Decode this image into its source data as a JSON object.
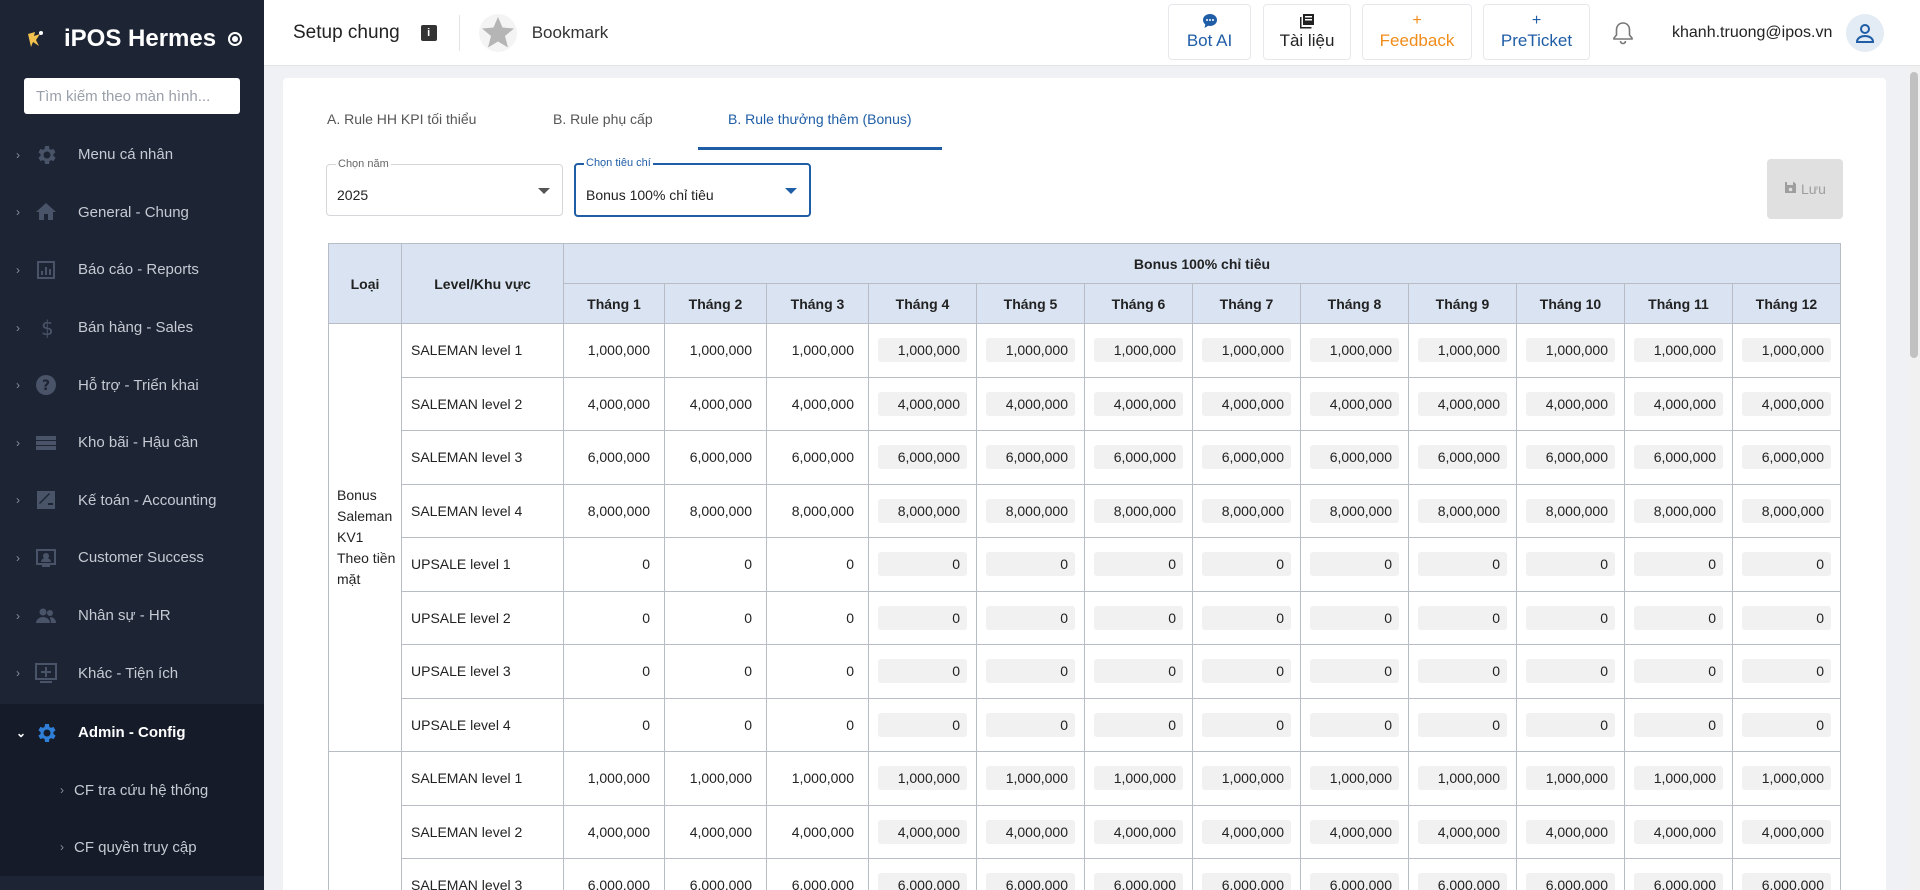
{
  "app": {
    "name": "iPOS Hermes"
  },
  "sidebar": {
    "search_placeholder": "Tìm kiếm theo màn hình...",
    "items": [
      {
        "label": "Menu cá nhân",
        "icon": "gear-icon"
      },
      {
        "label": "General - Chung",
        "icon": "home-icon"
      },
      {
        "label": "Báo cáo - Reports",
        "icon": "bar-chart-icon"
      },
      {
        "label": "Bán hàng - Sales",
        "icon": "dollar-icon"
      },
      {
        "label": "Hỗ trợ - Triển khai",
        "icon": "help-icon"
      },
      {
        "label": "Kho bãi - Hậu cần",
        "icon": "storage-icon"
      },
      {
        "label": "Kế toán - Accounting",
        "icon": "accounting-icon"
      },
      {
        "label": "Customer Success",
        "icon": "customer-icon"
      },
      {
        "label": "Nhân sự - HR",
        "icon": "people-icon"
      },
      {
        "label": "Khác - Tiện ích",
        "icon": "add-box-icon"
      },
      {
        "label": "Admin - Config",
        "icon": "settings-icon",
        "active": true
      }
    ],
    "sub_items": [
      {
        "label": "CF tra cứu hệ thống"
      },
      {
        "label": "CF quyền truy cập"
      }
    ]
  },
  "header": {
    "title": "Setup chung",
    "bookmark_label": "Bookmark",
    "buttons": {
      "bot_ai": "Bot AI",
      "tai_lieu": "Tài liệu",
      "feedback": "Feedback",
      "preticket": "PreTicket"
    },
    "user_email": "khanh.truong@ipos.vn"
  },
  "tabs": [
    {
      "label": "A. Rule HH KPI tối thiểu"
    },
    {
      "label": "B. Rule phụ cấp"
    },
    {
      "label": "B. Rule thưởng thêm (Bonus)",
      "active": true
    }
  ],
  "filters": {
    "year": {
      "label": "Chọn năm",
      "value": "2025"
    },
    "criteria": {
      "label": "Chọn tiêu chí",
      "value": "Bonus 100% chỉ tiêu"
    }
  },
  "save_label": "Lưu",
  "table": {
    "col_loai": "Loại",
    "col_level": "Level/Khu vực",
    "group_header": "Bonus 100% chỉ tiêu",
    "months": [
      "Tháng 1",
      "Tháng 2",
      "Tháng 3",
      "Tháng 4",
      "Tháng 5",
      "Tháng 6",
      "Tháng 7",
      "Tháng 8",
      "Tháng 9",
      "Tháng 10",
      "Tháng 11",
      "Tháng 12"
    ],
    "groups": [
      {
        "loai": "Bonus Saleman KV1 Theo tiền mặt",
        "rows": [
          {
            "level": "SALEMAN level 1",
            "value": "1,000,000"
          },
          {
            "level": "SALEMAN level 2",
            "value": "4,000,000"
          },
          {
            "level": "SALEMAN level 3",
            "value": "6,000,000"
          },
          {
            "level": "SALEMAN level 4",
            "value": "8,000,000"
          },
          {
            "level": "UPSALE level 1",
            "value": "0"
          },
          {
            "level": "UPSALE level 2",
            "value": "0"
          },
          {
            "level": "UPSALE level 3",
            "value": "0"
          },
          {
            "level": "UPSALE level 4",
            "value": "0"
          }
        ]
      },
      {
        "loai": "",
        "rows": [
          {
            "level": "SALEMAN level 1",
            "value": "1,000,000"
          },
          {
            "level": "SALEMAN level 2",
            "value": "4,000,000"
          },
          {
            "level": "SALEMAN level 3",
            "value": "6,000,000"
          }
        ]
      }
    ]
  }
}
